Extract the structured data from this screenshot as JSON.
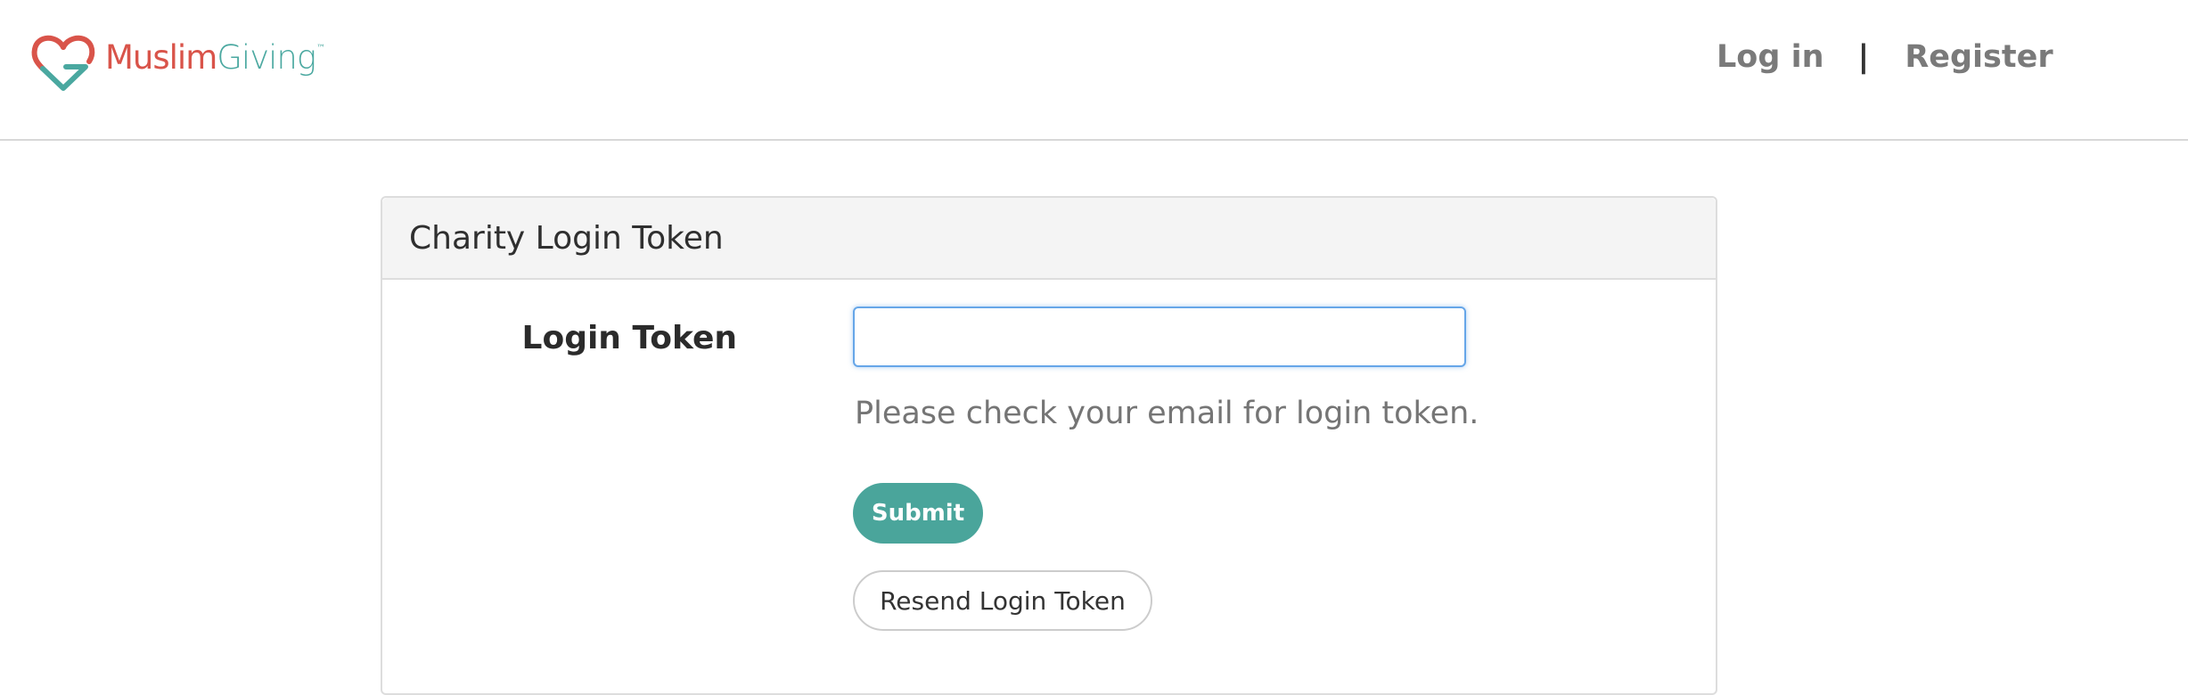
{
  "header": {
    "logo": {
      "brand_part1": "Muslim",
      "brand_part2": "Giving",
      "trademark": "™"
    },
    "nav": {
      "login_label": "Log in",
      "separator": "|",
      "register_label": "Register"
    }
  },
  "panel": {
    "title": "Charity Login Token",
    "form": {
      "token_label": "Login Token",
      "token_value": "",
      "token_placeholder": "",
      "help_text": "Please check your email for login token.",
      "submit_label": "Submit",
      "resend_label": "Resend Login Token"
    }
  },
  "colors": {
    "brand_red": "#d9544a",
    "brand_teal": "#4aa8a0",
    "submit_bg": "#4aa59b",
    "input_focus_border": "#66a6e8",
    "nav_text": "#7a7a7a"
  },
  "icons": {
    "logo": "heart-g-logo-icon"
  }
}
